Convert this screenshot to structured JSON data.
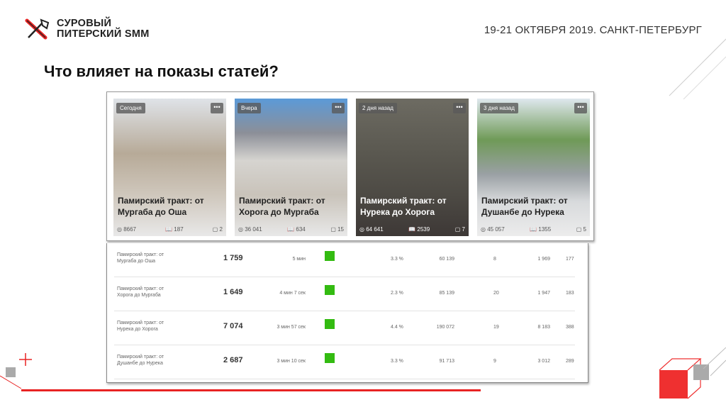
{
  "header": {
    "logo_line1": "СУРОВЫЙ",
    "logo_line2": "ПИТЕРСКИЙ SMM",
    "event": "19-21 ОКТЯБРЯ 2019. САНКТ-ПЕТЕРБУРГ"
  },
  "title": "Что влияет на показы статей?",
  "cards": [
    {
      "badge": "Сегодня",
      "title": "Памирский тракт: от Мургаба до Оша",
      "views": "8667",
      "reads": "187",
      "comments": "2",
      "bg": "linear-gradient(#dfe3e8 0%,#b7aa98 40%,#cfc7bc 70%,#e8e8e8 100%)"
    },
    {
      "badge": "Вчера",
      "title": "Памирский тракт: от Хорога до Мургаба",
      "views": "36 041",
      "reads": "634",
      "comments": "15",
      "bg": "linear-gradient(#5b9ad8 0%,#8c8f98 25%,#d6d4d0 45%,#c9c3ba 70%,#e8e8e8 100%)"
    },
    {
      "badge": "2 дня назад",
      "title": "Памирский тракт: от Нурека до Хорога",
      "views": "64 641",
      "reads": "2539",
      "comments": "7",
      "bg": "linear-gradient(#6d6b62 0%,#5a5850 40%,#4d4a44 70%,#3d3836 100%)",
      "dark": true
    },
    {
      "badge": "3 дня назад",
      "title": "Памирский тракт: от Душанбе до Нурека",
      "views": "45 057",
      "reads": "1355",
      "comments": "5",
      "bg": "linear-gradient(#dfe8ee 0%,#6f9a57 30%,#9aa0a4 55%,#d8dadc 75%,#ececec 100%)"
    }
  ],
  "table": [
    {
      "name": "Памирский тракт: от Мургаба до Оша",
      "value": "1 759",
      "time": "5 мин",
      "pct": "3.3 %",
      "v1": "60 139",
      "v2": "8",
      "v3": "1 969",
      "v4": "177"
    },
    {
      "name": "Памирский тракт: от Хорога до Мургаба",
      "value": "1 649",
      "time": "4 мин 7 сек",
      "pct": "2.3 %",
      "v1": "85 139",
      "v2": "20",
      "v3": "1 947",
      "v4": "183"
    },
    {
      "name": "Памирский тракт: от Нурека до Хорога",
      "value": "7 074",
      "time": "3 мин 57 сек",
      "pct": "4.4 %",
      "v1": "190 072",
      "v2": "19",
      "v3": "8 183",
      "v4": "388"
    },
    {
      "name": "Памирский тракт: от Душанбе до Нурека",
      "value": "2 687",
      "time": "3 мин 10 сек",
      "pct": "3.3 %",
      "v1": "91 713",
      "v2": "9",
      "v3": "3 012",
      "v4": "289"
    }
  ],
  "colors": {
    "accent": "#e82323",
    "green": "#33bb11"
  }
}
